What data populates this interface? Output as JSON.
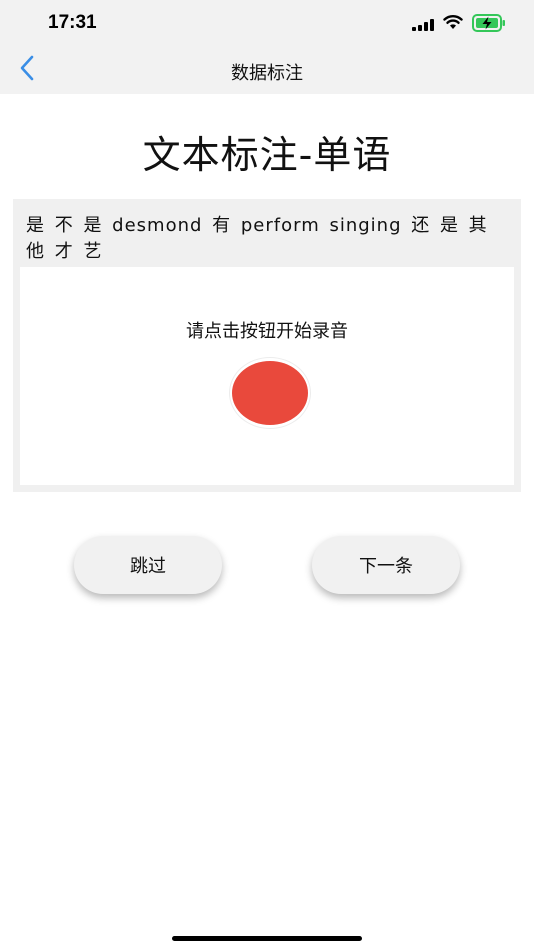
{
  "status_bar": {
    "time": "17:31",
    "icons": [
      "signal-icon",
      "wifi-icon",
      "battery-charging-icon"
    ],
    "battery_color": "#34c759"
  },
  "nav": {
    "title": "数据标注",
    "back_icon": "chevron-left-icon",
    "accent": "#3a8ee6"
  },
  "page": {
    "title": "文本标注-单语"
  },
  "card": {
    "sentence": "是 不 是 desmond 有 perform singing 还 是 其 他 才 艺",
    "record_hint": "请点击按钮开始录音",
    "record_color": "#e9493c"
  },
  "actions": {
    "skip_label": "跳过",
    "next_label": "下一条"
  }
}
